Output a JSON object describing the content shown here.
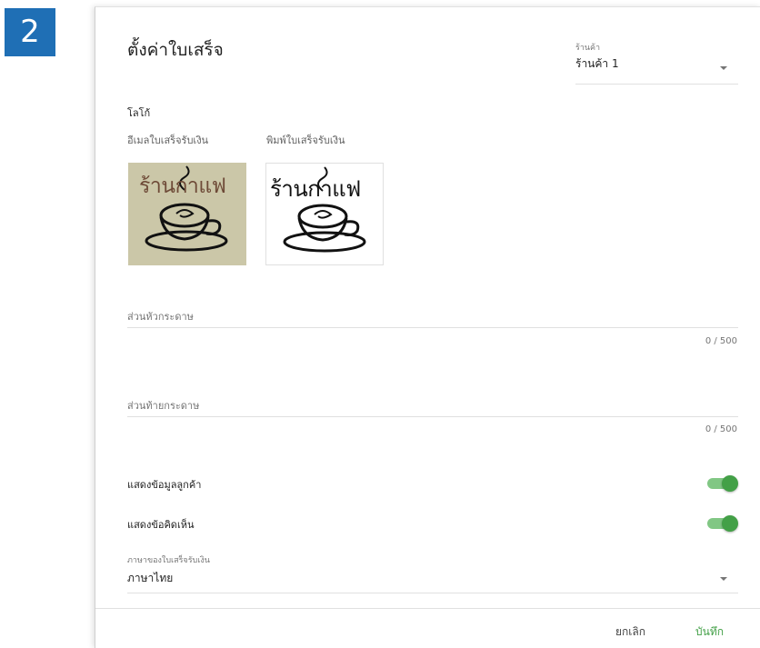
{
  "step_badge": "2",
  "dialog": {
    "title": "ตั้งค่าใบเสร็จ",
    "store": {
      "caption": "ร้านค้า",
      "value": "ร้านค้า 1"
    },
    "logo": {
      "heading": "โลโก้",
      "email_caption": "อีเมลใบเสร็จรับเงิน",
      "print_caption": "พิมพ์ใบเสร็จรับเงิน",
      "email_logo_text": "ร้านกาแฟ",
      "print_logo_text": "ร้านกาแฟ"
    },
    "header_field": {
      "placeholder": "ส่วนหัวกระดาษ",
      "counter": "0 / 500"
    },
    "footer_field": {
      "placeholder": "ส่วนท้ายกระดาษ",
      "counter": "0 / 500"
    },
    "toggles": {
      "show_customer": {
        "label": "แสดงข้อมูลลูกค้า",
        "on": true
      },
      "show_comment": {
        "label": "แสดงข้อคิดเห็น",
        "on": true
      }
    },
    "language": {
      "caption": "ภาษาของใบเสร็จรับเงิน",
      "value": "ภาษาไทย"
    },
    "buttons": {
      "cancel": "ยกเลิก",
      "save": "บันทึก"
    },
    "colors": {
      "accent_green": "#43a047",
      "badge_blue": "#1f6fb5"
    }
  }
}
